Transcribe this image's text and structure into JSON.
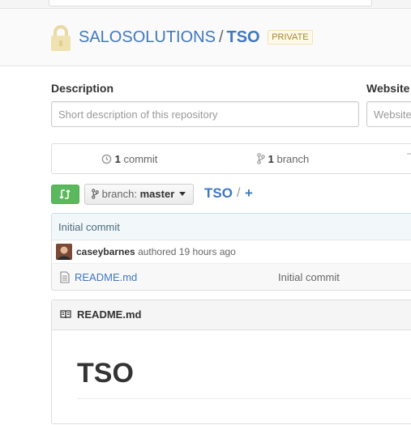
{
  "repo": {
    "owner": "SALOSOLUTIONS",
    "separator": "/",
    "name": "TSO",
    "visibility_badge": "PRIVATE"
  },
  "edit_form": {
    "description_label": "Description",
    "description_placeholder": "Short description of this repository",
    "website_label": "Website",
    "website_placeholder": "Website"
  },
  "summary": {
    "commits_count": "1",
    "commits_label": "commit",
    "branches_count": "1",
    "branches_label": "branch"
  },
  "file_nav": {
    "branch_prefix": "branch:",
    "branch_name": "master",
    "breadcrumb_repo": "TSO",
    "breadcrumb_sep": "/",
    "add_file": "+"
  },
  "latest_commit": {
    "message": "Initial commit",
    "author": "caseybarnes",
    "authored_text": "authored 19 hours ago"
  },
  "files": [
    {
      "name": "README.md",
      "commit_message": "Initial commit"
    }
  ],
  "readme": {
    "header_title": "README.md",
    "heading": "TSO"
  },
  "colors": {
    "link": "#4078c0",
    "compare_button": "#5cb85c",
    "private_badge_bg": "#fff9ea",
    "commit_tease_bg": "#f2f8fa"
  },
  "icons": {
    "repo": "lock-icon",
    "commits": "history-icon",
    "branches": "git-branch-icon",
    "compare": "compare-icon",
    "file": "file-text-icon",
    "readme": "book-icon"
  }
}
